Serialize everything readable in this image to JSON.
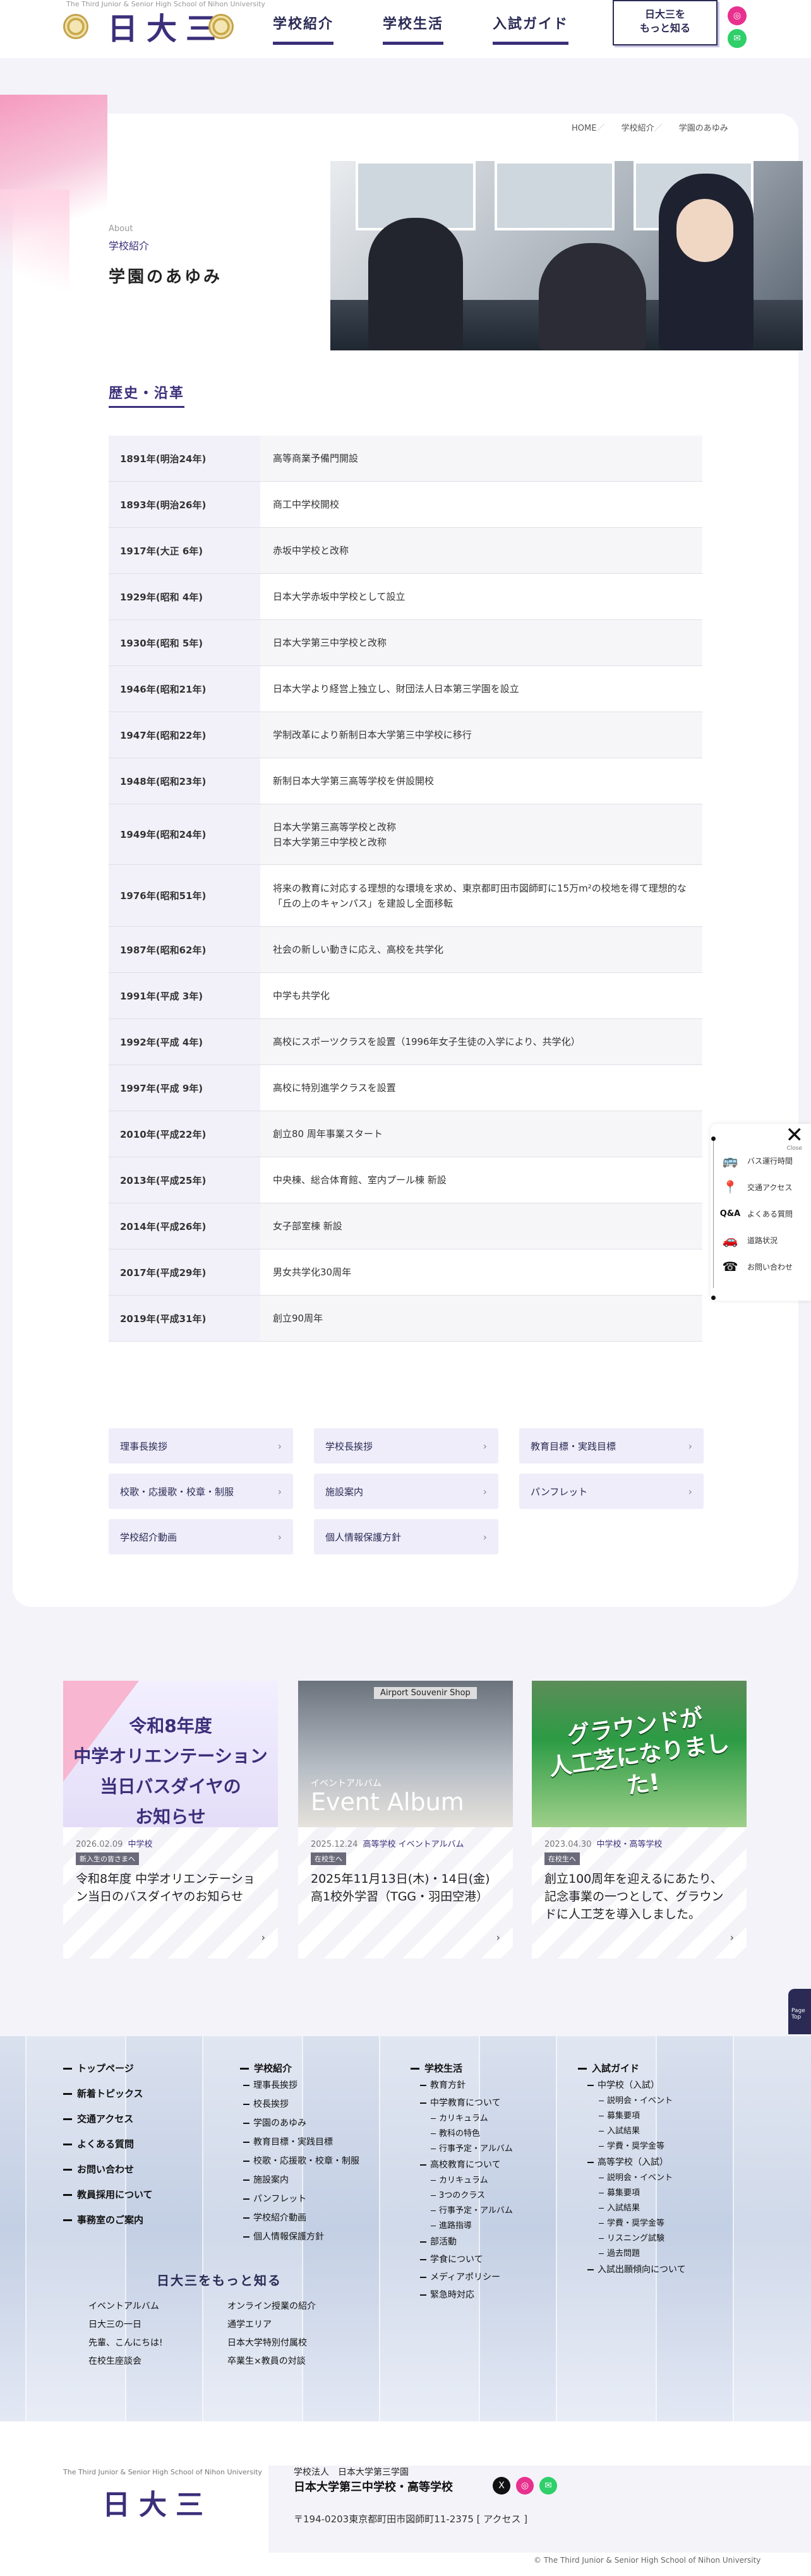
{
  "header": {
    "tagline": "The Third Junior & Senior High School of Nihon University",
    "logo": "日大三",
    "nav": [
      "学校紹介",
      "学校生活",
      "入試ガイド"
    ],
    "more_line1": "日大三を",
    "more_line2": "もっと知る"
  },
  "breadcrumb": [
    "HOME",
    "学校紹介",
    "学園のあゆみ"
  ],
  "page": {
    "about": "About",
    "category": "学校紹介",
    "title": "学園のあゆみ"
  },
  "history_title": "歴史・沿革",
  "history": [
    {
      "year": "1891年(明治24年)",
      "event": "高等商業予備門開設"
    },
    {
      "year": "1893年(明治26年)",
      "event": "商工中学校開校"
    },
    {
      "year": "1917年(大正 6年)",
      "event": "赤坂中学校と改称"
    },
    {
      "year": "1929年(昭和 4年)",
      "event": "日本大学赤坂中学校として設立"
    },
    {
      "year": "1930年(昭和 5年)",
      "event": "日本大学第三中学校と改称"
    },
    {
      "year": "1946年(昭和21年)",
      "event": "日本大学より経営上独立し、財団法人日本第三学園を設立"
    },
    {
      "year": "1947年(昭和22年)",
      "event": "学制改革により新制日本大学第三中学校に移行"
    },
    {
      "year": "1948年(昭和23年)",
      "event": "新制日本大学第三高等学校を併設開校"
    },
    {
      "year": "1949年(昭和24年)",
      "event": "日本大学第三高等学校と改称\n日本大学第三中学校と改称"
    },
    {
      "year": "1976年(昭和51年)",
      "event": "将来の教育に対応する理想的な環境を求め、東京都町田市図師町に15万m²の校地を得て理想的な「丘の上のキャンパス」を建設し全面移転"
    },
    {
      "year": "1987年(昭和62年)",
      "event": "社会の新しい動きに応え、高校を共学化"
    },
    {
      "year": "1991年(平成 3年)",
      "event": "中学も共学化"
    },
    {
      "year": "1992年(平成 4年)",
      "event": "高校にスポーツクラスを設置（1996年女子生徒の入学により、共学化）"
    },
    {
      "year": "1997年(平成 9年)",
      "event": "高校に特別進学クラスを設置"
    },
    {
      "year": "2010年(平成22年)",
      "event": "創立80 周年事業スタート"
    },
    {
      "year": "2013年(平成25年)",
      "event": "中央棟、総合体育館、室内プール棟 新設"
    },
    {
      "year": "2014年(平成26年)",
      "event": "女子部室棟 新設"
    },
    {
      "year": "2017年(平成29年)",
      "event": "男女共学化30周年"
    },
    {
      "year": "2019年(平成31年)",
      "event": "創立90周年"
    }
  ],
  "quick_links": [
    "理事長挨拶",
    "学校長挨拶",
    "教育目標・実践目標",
    "校歌・応援歌・校章・制服",
    "施設案内",
    "パンフレット",
    "学校紹介動画",
    "個人情報保護方針"
  ],
  "side_widget": {
    "close_label": "Close",
    "items": [
      "バス運行時間",
      "交通アクセス",
      "よくある質問",
      "道路状況",
      "お問い合わせ"
    ]
  },
  "news": [
    {
      "img_text": "令和8年度\n中学オリエンテーション\n当日バスダイヤの\nお知らせ",
      "date": "2026.02.09",
      "cat": "中学校",
      "tag": "新入生の皆さまへ",
      "title": "令和8年度 中学オリエンテーション当日のバスダイヤのお知らせ"
    },
    {
      "img_label": "イベントアルバム",
      "img_big": "Event Album",
      "img_shop": "Airport Souvenir Shop",
      "date": "2025.12.24",
      "cat": "高等学校 イベントアルバム",
      "tag": "在校生へ",
      "title": "2025年11月13日(木)・14日(金)高1校外学習（TGG・羽田空港）"
    },
    {
      "img_text": "グラウンドが\n人工芝になりました!",
      "date": "2023.04.30",
      "cat": "中学校・高等学校",
      "tag": "在校生へ",
      "title": "創立100周年を迎えるにあたり、記念事業の一つとして、グラウンドに人工芝を導入しました。"
    }
  ],
  "page_top": "Page\nTop",
  "footer_nav": {
    "col1": [
      "トップページ",
      "新着トピックス",
      "交通アクセス",
      "よくある質問",
      "お問い合わせ",
      "教員採用について",
      "事務室のご案内"
    ],
    "col2_title": "学校紹介",
    "col2": [
      "理事長挨拶",
      "校長挨拶",
      "学園のあゆみ",
      "教育目標・実践目標",
      "校歌・応援歌・校章・制服",
      "施設案内",
      "パンフレット",
      "学校紹介動画",
      "個人情報保護方針"
    ],
    "col3_title": "学校生活",
    "col3_main": [
      "教育方針",
      "中学教育について",
      "高校教育について",
      "部活動",
      "学食について",
      "メディアポリシー",
      "緊急時対応"
    ],
    "col3_sub1": [
      "カリキュラム",
      "教科の特色",
      "行事予定・アルバム"
    ],
    "col3_sub2": [
      "カリキュラム",
      "3つのクラス",
      "行事予定・アルバム",
      "進路指導"
    ],
    "col4_title": "入試ガイド",
    "col4_jh": "中学校（入試）",
    "col4_jh_sub": [
      "説明会・イベント",
      "募集要項",
      "入試結果",
      "学費・奨学金等"
    ],
    "col4_hs": "高等学校（入試）",
    "col4_hs_sub": [
      "説明会・イベント",
      "募集要項",
      "入試結果",
      "学費・奨学金等",
      "リスニング試験",
      "過去問題"
    ],
    "col4_last": "入試出願傾向について",
    "more_title": "日大三をもっと知る",
    "more_links": [
      "イベントアルバム",
      "オンライン授業の紹介",
      "日大三の一日",
      "通学エリア",
      "先輩、こんにちは!",
      "日本大学特別付属校",
      "在校生座談会",
      "卒業生×教員の対談"
    ]
  },
  "footer": {
    "tagline": "The Third Junior & Senior High School of Nihon University",
    "logo": "日大三",
    "corp": "学校法人　日本大学第三学園",
    "school": "日本大学第三中学校・高等学校",
    "addr": "〒194-0203東京都町田市図師町11-2375 [ アクセス ]",
    "copyright": "© The Third Junior & Senior High School of Nihon University"
  }
}
